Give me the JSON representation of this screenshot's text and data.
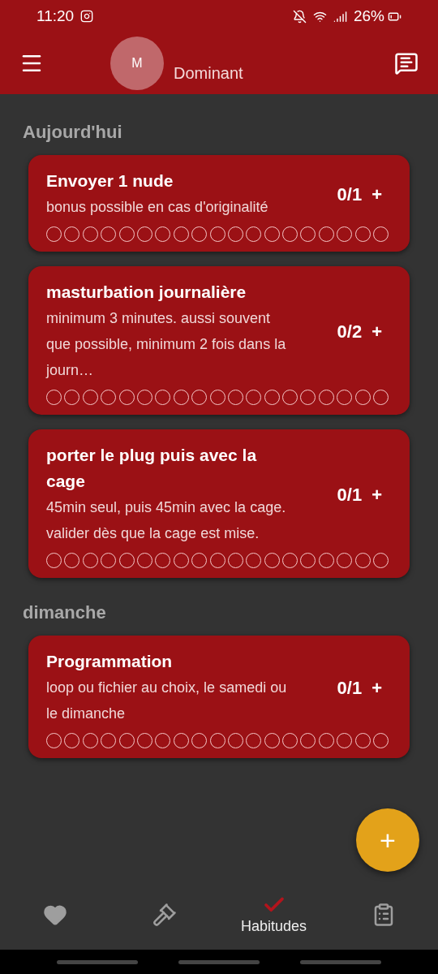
{
  "status_bar": {
    "time": "11:20",
    "battery": "26%"
  },
  "header": {
    "avatar_letter": "M",
    "role": "Dominant"
  },
  "sections": [
    {
      "title": "Aujourd'hui",
      "habits": [
        {
          "title": "Envoyer 1 nude",
          "description": "bonus possible en cas d'originalité",
          "count": "0/1",
          "add": "+",
          "history": [
            false,
            false,
            false,
            false,
            false,
            false,
            false,
            false,
            false,
            false,
            false,
            false,
            false,
            false,
            false,
            false,
            false,
            false,
            false
          ]
        },
        {
          "title": "masturbation journalière",
          "description": "minimum 3 minutes. aussi souvent que possible, minimum 2 fois dans la journ…",
          "count": "0/2",
          "add": "+",
          "history": [
            false,
            false,
            false,
            false,
            false,
            false,
            false,
            false,
            false,
            false,
            false,
            false,
            false,
            false,
            false,
            false,
            false,
            false,
            false
          ]
        },
        {
          "title": "porter le plug puis avec la cage",
          "description": "45min seul, puis 45min avec la cage. valider dès que la cage est mise.",
          "count": "0/1",
          "add": "+",
          "history": [
            false,
            false,
            false,
            false,
            false,
            false,
            false,
            false,
            false,
            false,
            false,
            false,
            false,
            false,
            false,
            false,
            false,
            false,
            false
          ]
        }
      ]
    },
    {
      "title": "dimanche",
      "habits": [
        {
          "title": "Programmation",
          "description": "loop ou fichier au choix, le samedi ou le dimanche",
          "count": "0/1",
          "add": "+",
          "history": [
            false,
            false,
            false,
            false,
            false,
            false,
            false,
            false,
            false,
            false,
            false,
            false,
            false,
            false,
            false,
            false,
            false,
            false,
            false
          ]
        }
      ]
    }
  ],
  "fab": "+",
  "nav": [
    {
      "kind": "heart",
      "selected": false
    },
    {
      "kind": "gavel",
      "selected": false
    },
    {
      "kind": "check",
      "label": "Habitudes",
      "selected": true
    },
    {
      "kind": "clipboard",
      "selected": false
    }
  ]
}
